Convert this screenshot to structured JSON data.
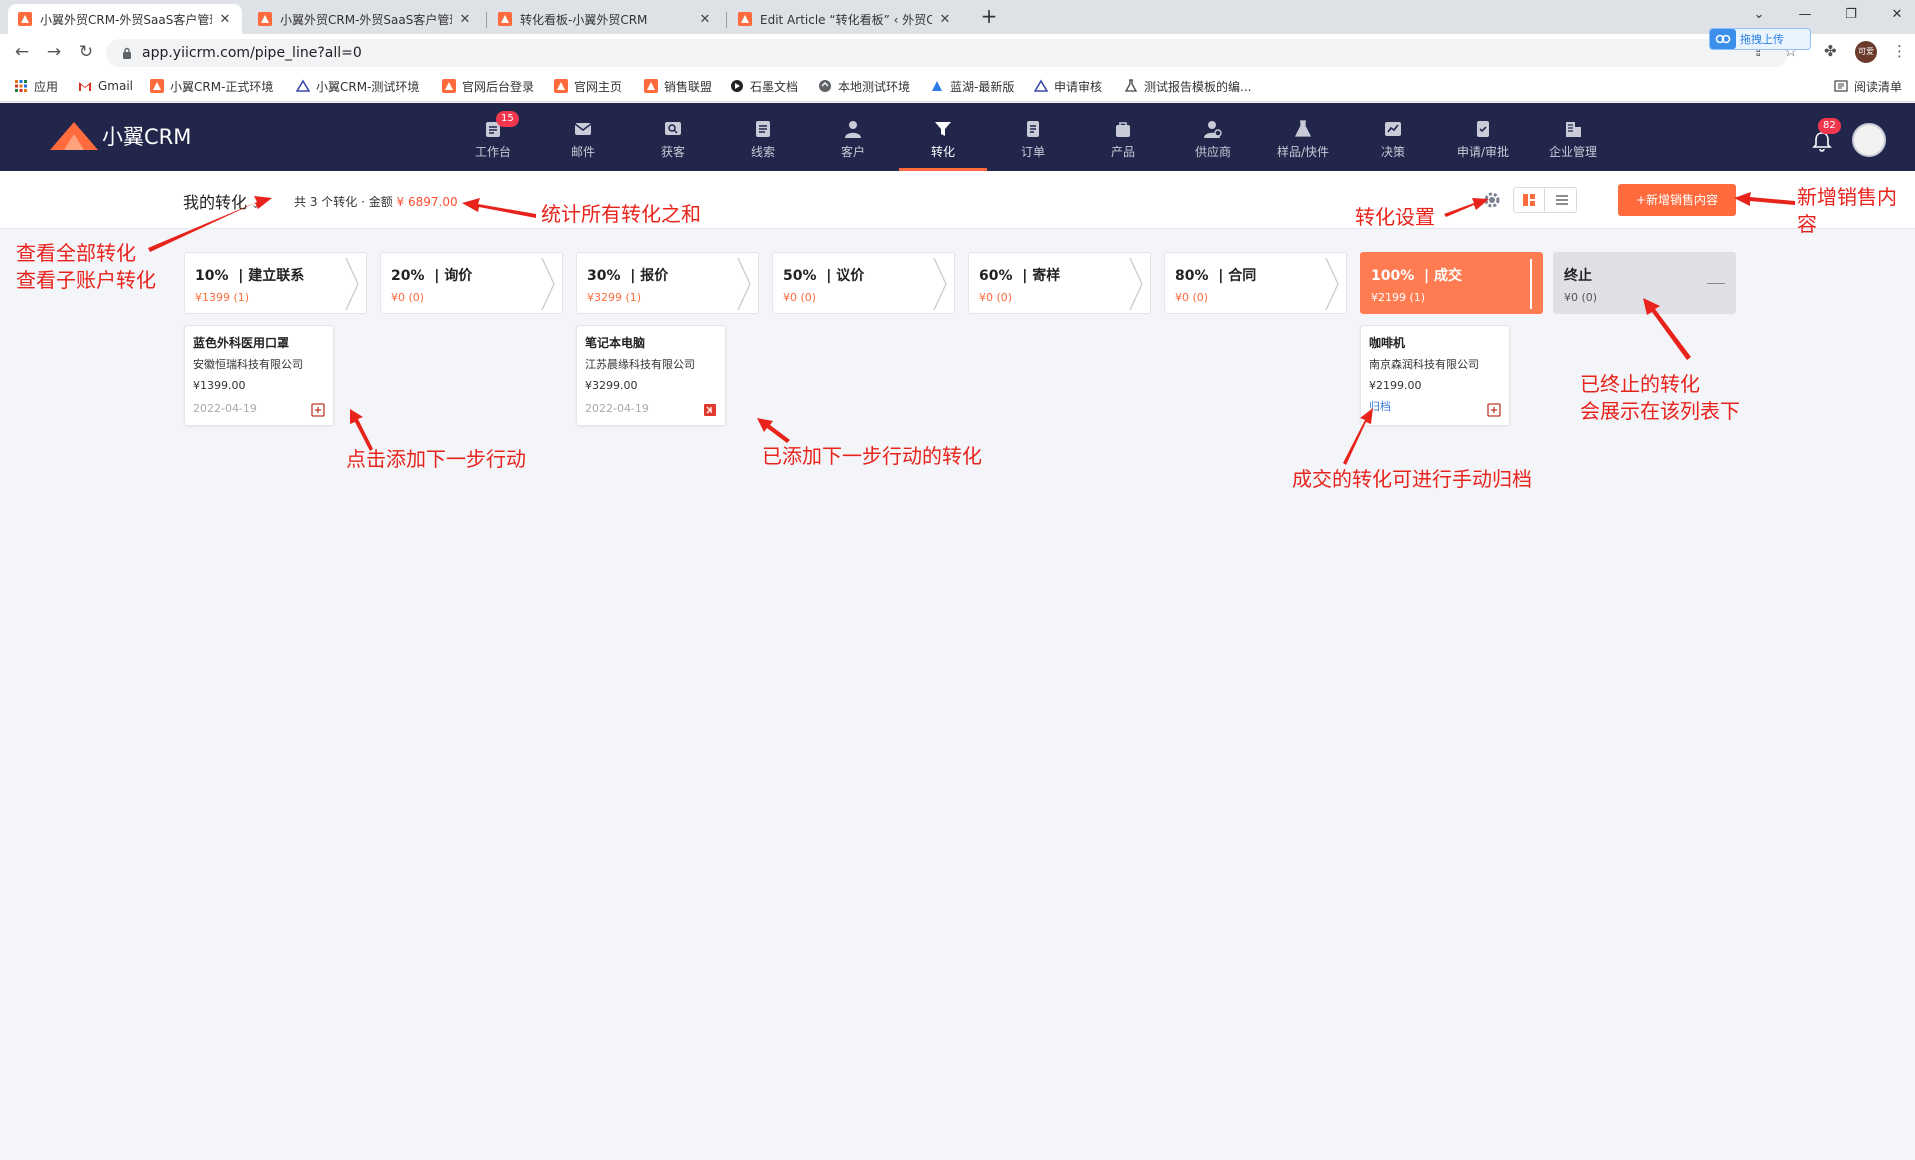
{
  "browser": {
    "tabs": [
      {
        "title": "小翼外贸CRM-外贸SaaS客户管理",
        "active": true
      },
      {
        "title": "小翼外贸CRM-外贸SaaS客户管理",
        "active": false
      },
      {
        "title": "转化看板-小翼外贸CRM",
        "active": false
      },
      {
        "title": "Edit Article “转化看板” ‹ 外贸CR",
        "active": false
      }
    ],
    "url": "app.yiicrm.com/pipe_line?all=0",
    "baidu_upload": "拖拽上传",
    "profile": "可爱",
    "bookmarks": [
      "应用",
      "Gmail",
      "小翼CRM-正式环境",
      "小翼CRM-测试环境",
      "官网后台登录",
      "官网主页",
      "销售联盟",
      "石墨文档",
      "本地测试环境",
      "蓝湖-最新版",
      "申请审核",
      "测试报告模板的编..."
    ],
    "reading_list": "阅读清单"
  },
  "app": {
    "logo": "小翼CRM",
    "nav": [
      {
        "label": "工作台",
        "icon": "dashboard-icon",
        "badge": "15"
      },
      {
        "label": "邮件",
        "icon": "mail-icon"
      },
      {
        "label": "获客",
        "icon": "leads-search-icon"
      },
      {
        "label": "线索",
        "icon": "clue-icon"
      },
      {
        "label": "客户",
        "icon": "customer-icon"
      },
      {
        "label": "转化",
        "icon": "funnel-icon",
        "active": true
      },
      {
        "label": "订单",
        "icon": "order-icon"
      },
      {
        "label": "产品",
        "icon": "product-icon"
      },
      {
        "label": "供应商",
        "icon": "supplier-icon"
      },
      {
        "label": "样品/快件",
        "icon": "sample-icon"
      },
      {
        "label": "决策",
        "icon": "chart-icon"
      },
      {
        "label": "申请/审批",
        "icon": "approval-icon"
      },
      {
        "label": "企业管理",
        "icon": "company-icon"
      }
    ],
    "notification_count": "82",
    "accent": "#ff6b3d",
    "header_bg": "#21264a"
  },
  "toolbar": {
    "scope": "我的转化",
    "summary_prefix": "共 3 个转化 · 金额",
    "summary_amount": "¥ 6897.00",
    "add_button": "+新增销售内容"
  },
  "stages": [
    {
      "pct": "10%",
      "name": "建立联系",
      "amount": "¥1399 (1)"
    },
    {
      "pct": "20%",
      "name": "询价",
      "amount": "¥0 (0)"
    },
    {
      "pct": "30%",
      "name": "报价",
      "amount": "¥3299 (1)"
    },
    {
      "pct": "50%",
      "name": "议价",
      "amount": "¥0 (0)"
    },
    {
      "pct": "60%",
      "name": "寄样",
      "amount": "¥0 (0)"
    },
    {
      "pct": "80%",
      "name": "合同",
      "amount": "¥0 (0)"
    },
    {
      "pct": "100%",
      "name": "成交",
      "amount": "¥2199 (1)"
    }
  ],
  "ended_stage": {
    "name": "终止",
    "amount": "¥0 (0)"
  },
  "cards": [
    {
      "name": "蓝色外科医用口罩",
      "company": "安徽恒瑞科技有限公司",
      "value": "¥1399.00",
      "date": "2022-04-19"
    },
    {
      "name": "笔记本电脑",
      "company": "江苏晨缘科技有限公司",
      "value": "¥3299.00",
      "date": "2022-04-19"
    },
    {
      "name": "咖啡机",
      "company": "南京森润科技有限公司",
      "value": "¥2199.00",
      "archive": "归档"
    }
  ],
  "annotations": {
    "view_all": "查看全部转化",
    "view_sub": "查看子账户转化",
    "sum_all": "统计所有转化之和",
    "settings": "转化设置",
    "add_sales_1": "新增销售内",
    "add_sales_2": "容",
    "ended_1": "已终止的转化",
    "ended_2": "会展示在该列表下",
    "click_add": "点击添加下一步行动",
    "added": "已添加下一步行动的转化",
    "archive": "成交的转化可进行手动归档"
  }
}
